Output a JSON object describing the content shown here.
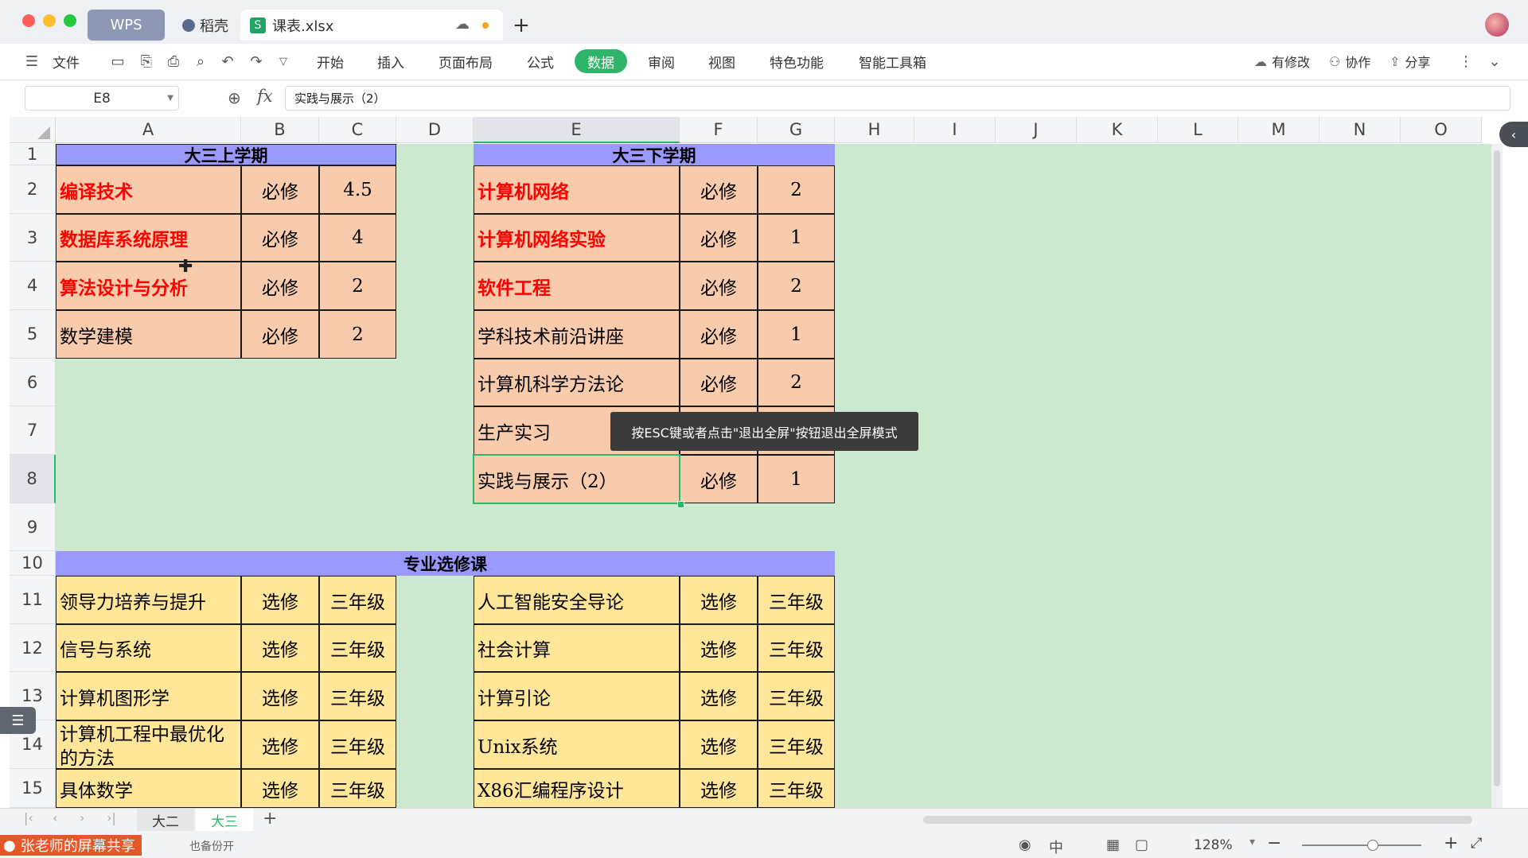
{
  "window": {
    "tabs": {
      "wps": "WPS",
      "docer": "稻壳",
      "file": "课表.xlsx",
      "new_tab": "+"
    }
  },
  "menu": {
    "file": "文件",
    "tabs": [
      "开始",
      "插入",
      "页面布局",
      "公式",
      "数据",
      "审阅",
      "视图",
      "特色功能",
      "智能工具箱"
    ],
    "active_tab": "数据",
    "right": {
      "changes": "有修改",
      "collab": "协作",
      "share": "分享"
    }
  },
  "formula_bar": {
    "name_box": "E8",
    "fx": "fx",
    "content": "实践与展示（2）"
  },
  "columns": [
    "A",
    "B",
    "C",
    "D",
    "E",
    "F",
    "G",
    "H",
    "I",
    "J",
    "K",
    "L",
    "M",
    "N",
    "O"
  ],
  "rows": [
    "1",
    "2",
    "3",
    "4",
    "5",
    "6",
    "7",
    "8",
    "9",
    "10",
    "11",
    "12",
    "13",
    "14",
    "15"
  ],
  "sheet": {
    "upper_title": "大三上学期",
    "lower_title": "大三下学期",
    "elective_title": "专业选修课",
    "upper": [
      [
        "编译技术",
        "必修",
        "4.5"
      ],
      [
        "数据库系统原理",
        "必修",
        "4"
      ],
      [
        "算法设计与分析",
        "必修",
        "2"
      ],
      [
        "数学建模",
        "必修",
        "2"
      ]
    ],
    "lower": [
      [
        "计算机网络",
        "必修",
        "2"
      ],
      [
        "计算机网络实验",
        "必修",
        "1"
      ],
      [
        "软件工程",
        "必修",
        "2"
      ],
      [
        "学科技术前沿讲座",
        "必修",
        "1"
      ],
      [
        "计算机科学方法论",
        "必修",
        "2"
      ],
      [
        "生产实习",
        "",
        ""
      ],
      [
        "实践与展示（2）",
        "必修",
        "1"
      ]
    ],
    "elective_left": [
      [
        "领导力培养与提升",
        "选修",
        "三年级"
      ],
      [
        "信号与系统",
        "选修",
        "三年级"
      ],
      [
        "计算机图形学",
        "选修",
        "三年级"
      ],
      [
        "计算机工程中最优化的方法",
        "选修",
        "三年级"
      ],
      [
        "具体数学",
        "选修",
        "三年级"
      ]
    ],
    "elective_right": [
      [
        "人工智能安全导论",
        "选修",
        "三年级"
      ],
      [
        "社会计算",
        "选修",
        "三年级"
      ],
      [
        "计算引论",
        "选修",
        "三年级"
      ],
      [
        "Unix系统",
        "选修",
        "三年级"
      ],
      [
        "X86汇编程序设计",
        "选修",
        "三年级"
      ]
    ]
  },
  "tooltip": "按ESC键或者点击\"退出全屏\"按钮退出全屏模式",
  "sheet_tabs": {
    "tab1": "大二",
    "tab2": "大三",
    "add": "+"
  },
  "status": {
    "share_label": "张老师的屏幕共享",
    "backup": "也备份开",
    "zoom": "128%"
  },
  "colors": {
    "active_tab": "#2eb56a",
    "header_purple": "#9999ff",
    "course_orange": "#f8cbad",
    "elective_yellow": "#ffe699",
    "sheet_bg": "#cce8cf",
    "red_text": "#ff0000"
  }
}
